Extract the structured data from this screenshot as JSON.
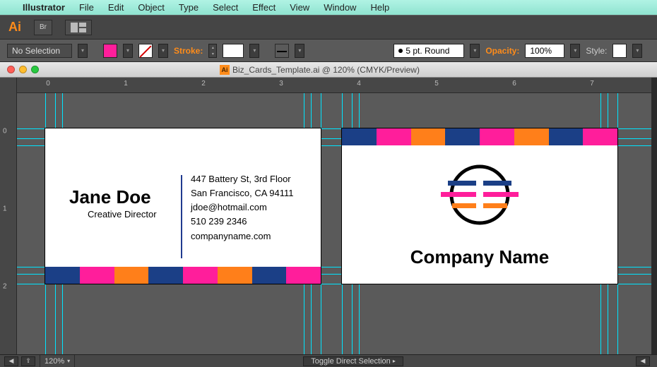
{
  "menubar": {
    "app": "Illustrator",
    "items": [
      "File",
      "Edit",
      "Object",
      "Type",
      "Select",
      "Effect",
      "View",
      "Window",
      "Help"
    ]
  },
  "topstrip": {
    "logo": "Ai",
    "chip_br": "Br"
  },
  "ctrl": {
    "selection": "No Selection",
    "stroke_label": "Stroke:",
    "stroke_val": "",
    "round_label": "5 pt. Round",
    "opacity_label": "Opacity:",
    "opacity_val": "100%",
    "style_label": "Style:"
  },
  "doc": {
    "title": "Biz_Cards_Template.ai @ 120% (CMYK/Preview)"
  },
  "hruler_nums": [
    "0",
    "1",
    "2",
    "3",
    "4",
    "5",
    "6",
    "7"
  ],
  "vruler_nums": [
    "0",
    "1",
    "2"
  ],
  "card1": {
    "name": "Jane Doe",
    "role": "Creative Director",
    "addr1": "447 Battery St, 3rd Floor",
    "addr2": "San Francisco, CA 94111",
    "email": "jdoe@hotmail.com",
    "phone": "510 239 2346",
    "site": "companyname.com"
  },
  "card2": {
    "company": "Company Name"
  },
  "status": {
    "zoom": "120%",
    "mode": "Toggle Direct Selection"
  }
}
